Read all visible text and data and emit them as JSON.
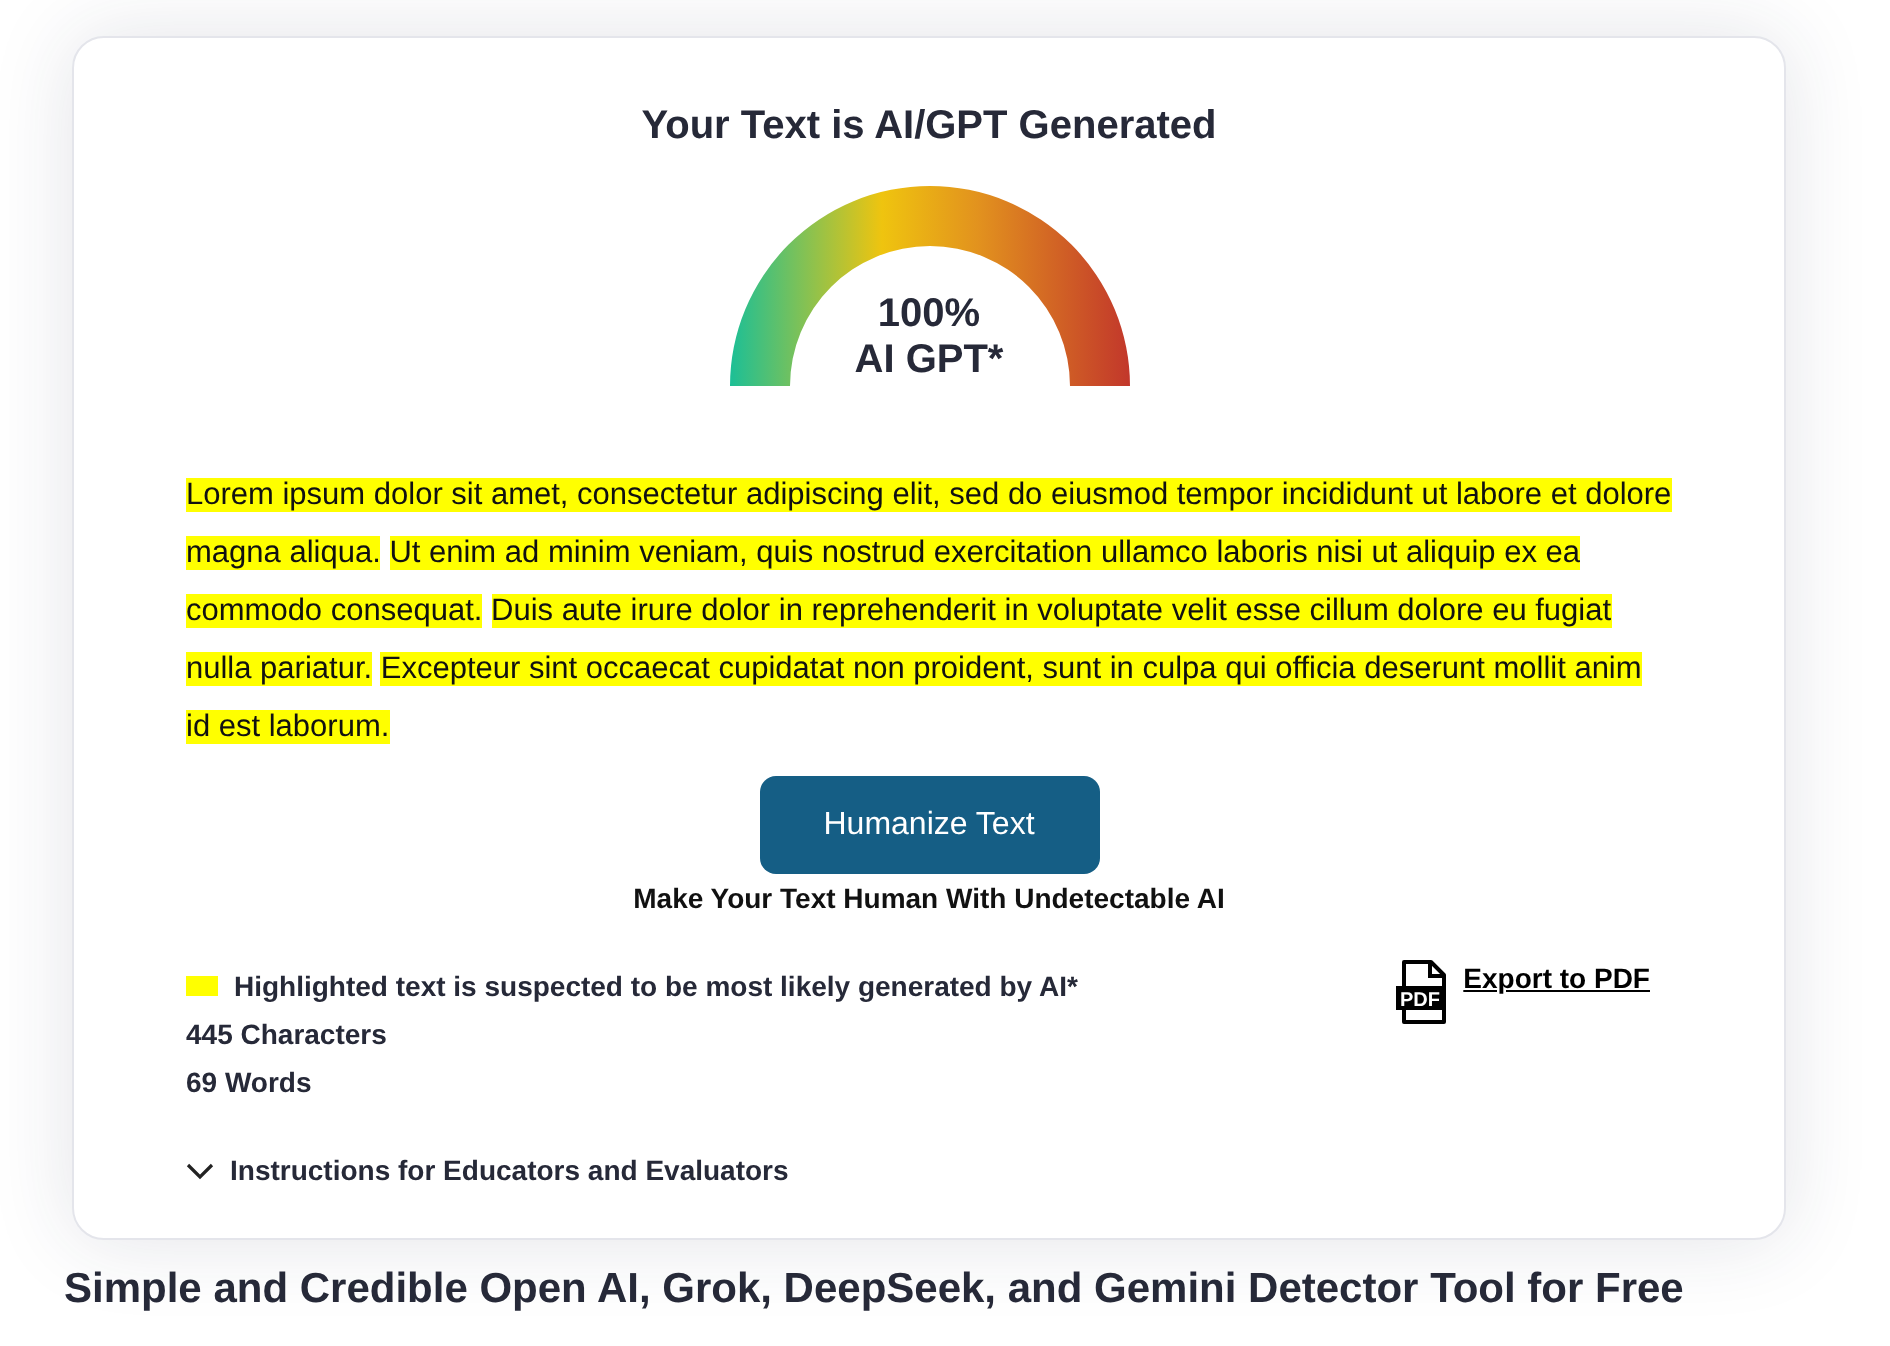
{
  "result": {
    "title": "Your Text is AI/GPT Generated"
  },
  "gauge": {
    "percent": "100%",
    "label": "AI GPT*"
  },
  "text": [
    {
      "sentence": "Lorem ipsum dolor sit amet, consectetur adipiscing elit, sed do eiusmod tempor incididunt ut labore et dolore magna aliqua.",
      "highlighted": true
    },
    {
      "sentence": "Ut enim ad minim veniam, quis nostrud exercitation ullamco laboris nisi ut aliquip ex ea commodo consequat.",
      "highlighted": true
    },
    {
      "sentence": "Duis aute irure dolor in reprehenderit in voluptate velit esse cillum dolore eu fugiat nulla pariatur.",
      "highlighted": true
    },
    {
      "sentence": "Excepteur sint occaecat cupidatat non proident, sunt in culpa qui officia deserunt mollit anim id est laborum.",
      "highlighted": true
    }
  ],
  "humanize": {
    "button": "Humanize Text",
    "caption": "Make Your Text Human With Undetectable AI"
  },
  "legend": {
    "text": "Highlighted text is suspected to be most likely generated by AI*"
  },
  "stats": {
    "characters": "445 Characters",
    "words": "69 Words"
  },
  "export": {
    "icon_label": "PDF",
    "link": "Export to PDF"
  },
  "instructions": {
    "label": "Instructions for Educators and Evaluators",
    "expanded": false
  },
  "next_section": {
    "heading": "Simple and Credible Open AI, Grok, DeepSeek, and Gemini Detector Tool for Free"
  }
}
